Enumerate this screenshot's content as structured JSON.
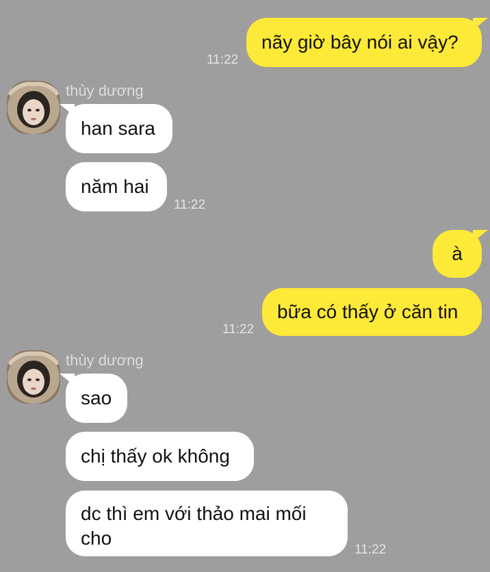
{
  "colors": {
    "background": "#9e9e9e",
    "outgoing_bubble": "#fde937",
    "incoming_bubble": "#ffffff",
    "timestamp": "#e4e4e4",
    "sender_name": "#dcdcdc"
  },
  "messages": [
    {
      "direction": "outgoing",
      "text": "nãy giờ bây nói ai vậy?",
      "time": "11:22"
    },
    {
      "direction": "incoming",
      "sender": "thùy dương",
      "avatar_icon": "profile-photo-fur-hood",
      "text": "han sara"
    },
    {
      "direction": "incoming",
      "text": "năm hai",
      "time": "11:22"
    },
    {
      "direction": "outgoing",
      "text": "à"
    },
    {
      "direction": "outgoing",
      "text": "bữa có thấy ở căn tin",
      "time": "11:22"
    },
    {
      "direction": "incoming",
      "sender": "thùy dương",
      "avatar_icon": "profile-photo-fur-hood",
      "text": "sao"
    },
    {
      "direction": "incoming",
      "text": "chị thấy ok không"
    },
    {
      "direction": "incoming",
      "text": "dc thì em với thảo mai mối cho",
      "time": "11:22"
    }
  ]
}
